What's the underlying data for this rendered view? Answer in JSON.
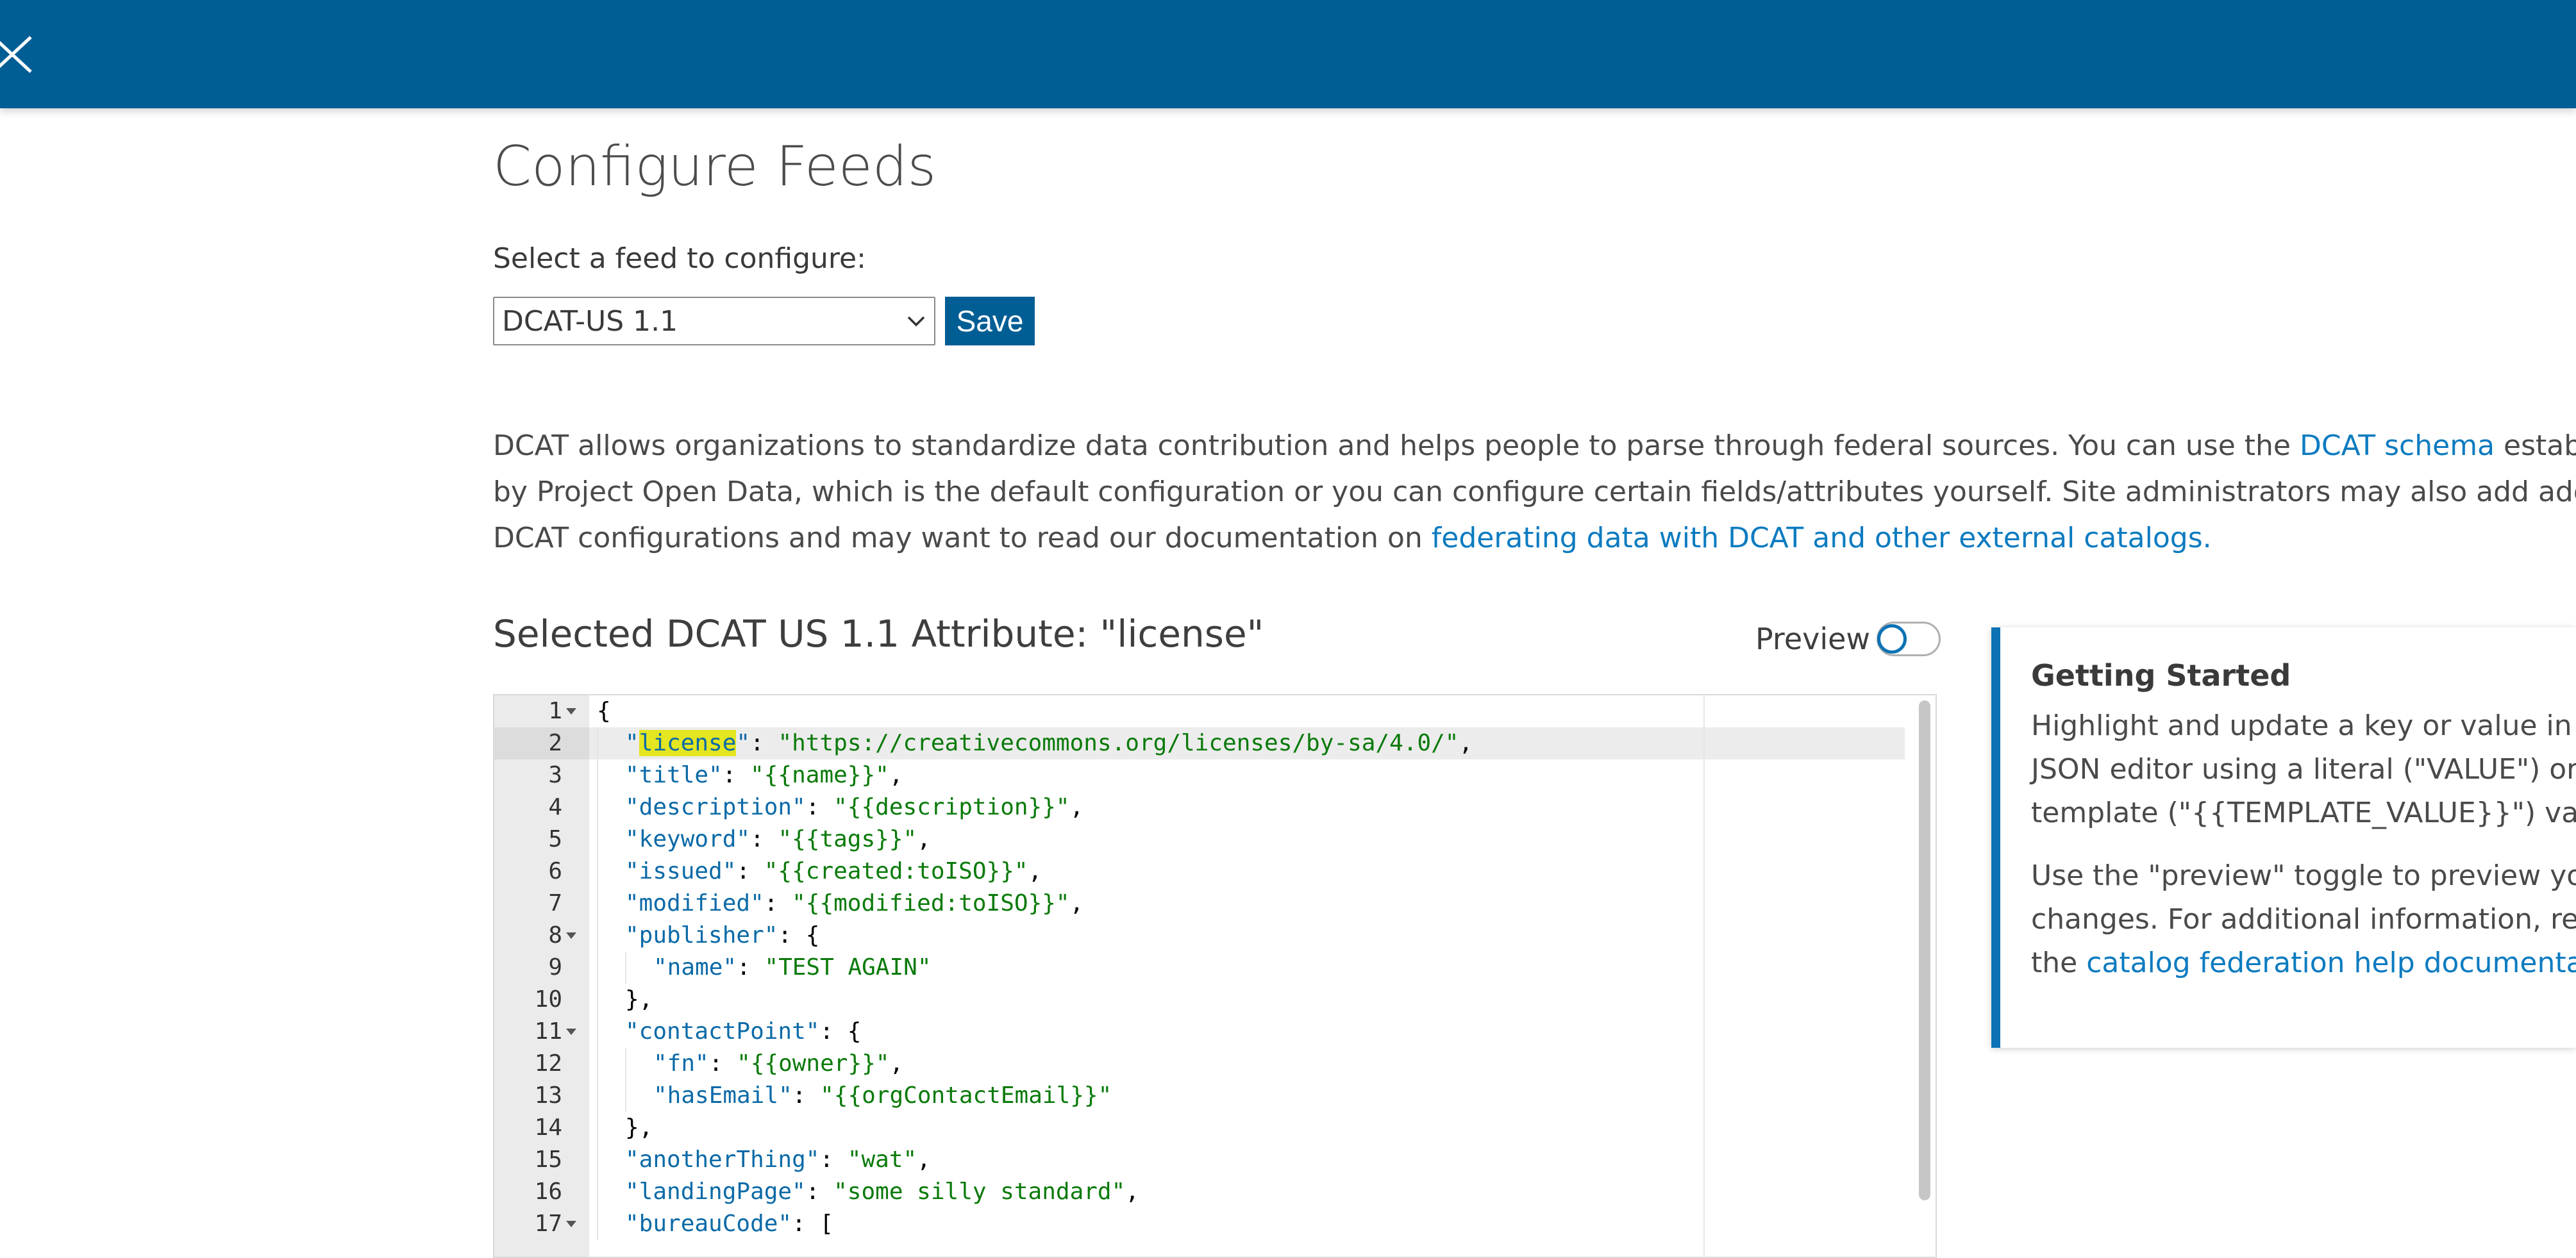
{
  "page": {
    "title": "Configure Feeds",
    "select_label": "Select a feed to configure:",
    "selected_feed": "DCAT-US 1.1",
    "save_label": "Save"
  },
  "description": {
    "line1_text": "DCAT allows organizations to standardize data contribution and helps people to parse through federal sources. You can use the ",
    "schema_link": "DCAT schema",
    "line1_tail": " establi",
    "line2_text": "by Project Open Data, which is the default configuration or you can configure certain fields/attributes yourself. Site administrators may also add additi",
    "line3_text": "DCAT configurations and may want to read our documentation on ",
    "federating_link": "federating data with DCAT and other external catalogs."
  },
  "editor": {
    "attribute_title": "Selected DCAT US 1.1 Attribute: \"license\"",
    "preview_label": "Preview",
    "lines": [
      {
        "n": "1",
        "fold": true,
        "indent": 0,
        "parts": [
          {
            "t": "{",
            "c": "p"
          }
        ]
      },
      {
        "n": "2",
        "fold": false,
        "indent": 1,
        "parts": [
          {
            "t": "\"",
            "c": "k"
          },
          {
            "t": "license",
            "c": "k",
            "hl": true
          },
          {
            "t": "\"",
            "c": "k"
          },
          {
            "t": ": ",
            "c": "p"
          },
          {
            "t": "\"https://creativecommons.org/licenses/by-sa/4.0/\"",
            "c": "s"
          },
          {
            "t": ",",
            "c": "p"
          }
        ]
      },
      {
        "n": "3",
        "fold": false,
        "indent": 1,
        "parts": [
          {
            "t": "\"title\"",
            "c": "k"
          },
          {
            "t": ": ",
            "c": "p"
          },
          {
            "t": "\"{{name}}\"",
            "c": "s"
          },
          {
            "t": ",",
            "c": "p"
          }
        ]
      },
      {
        "n": "4",
        "fold": false,
        "indent": 1,
        "parts": [
          {
            "t": "\"description\"",
            "c": "k"
          },
          {
            "t": ": ",
            "c": "p"
          },
          {
            "t": "\"{{description}}\"",
            "c": "s"
          },
          {
            "t": ",",
            "c": "p"
          }
        ]
      },
      {
        "n": "5",
        "fold": false,
        "indent": 1,
        "parts": [
          {
            "t": "\"keyword\"",
            "c": "k"
          },
          {
            "t": ": ",
            "c": "p"
          },
          {
            "t": "\"{{tags}}\"",
            "c": "s"
          },
          {
            "t": ",",
            "c": "p"
          }
        ]
      },
      {
        "n": "6",
        "fold": false,
        "indent": 1,
        "parts": [
          {
            "t": "\"issued\"",
            "c": "k"
          },
          {
            "t": ": ",
            "c": "p"
          },
          {
            "t": "\"{{created:toISO}}\"",
            "c": "s"
          },
          {
            "t": ",",
            "c": "p"
          }
        ]
      },
      {
        "n": "7",
        "fold": false,
        "indent": 1,
        "parts": [
          {
            "t": "\"modified\"",
            "c": "k"
          },
          {
            "t": ": ",
            "c": "p"
          },
          {
            "t": "\"{{modified:toISO}}\"",
            "c": "s"
          },
          {
            "t": ",",
            "c": "p"
          }
        ]
      },
      {
        "n": "8",
        "fold": true,
        "indent": 1,
        "parts": [
          {
            "t": "\"publisher\"",
            "c": "k"
          },
          {
            "t": ": {",
            "c": "p"
          }
        ]
      },
      {
        "n": "9",
        "fold": false,
        "indent": 2,
        "parts": [
          {
            "t": "\"name\"",
            "c": "k"
          },
          {
            "t": ": ",
            "c": "p"
          },
          {
            "t": "\"TEST AGAIN\"",
            "c": "s"
          }
        ]
      },
      {
        "n": "10",
        "fold": false,
        "indent": 1,
        "parts": [
          {
            "t": "},",
            "c": "p"
          }
        ]
      },
      {
        "n": "11",
        "fold": true,
        "indent": 1,
        "parts": [
          {
            "t": "\"contactPoint\"",
            "c": "k"
          },
          {
            "t": ": {",
            "c": "p"
          }
        ]
      },
      {
        "n": "12",
        "fold": false,
        "indent": 2,
        "parts": [
          {
            "t": "\"fn\"",
            "c": "k"
          },
          {
            "t": ": ",
            "c": "p"
          },
          {
            "t": "\"{{owner}}\"",
            "c": "s"
          },
          {
            "t": ",",
            "c": "p"
          }
        ]
      },
      {
        "n": "13",
        "fold": false,
        "indent": 2,
        "parts": [
          {
            "t": "\"hasEmail\"",
            "c": "k"
          },
          {
            "t": ": ",
            "c": "p"
          },
          {
            "t": "\"{{orgContactEmail}}\"",
            "c": "s"
          }
        ]
      },
      {
        "n": "14",
        "fold": false,
        "indent": 1,
        "parts": [
          {
            "t": "},",
            "c": "p"
          }
        ]
      },
      {
        "n": "15",
        "fold": false,
        "indent": 1,
        "parts": [
          {
            "t": "\"anotherThing\"",
            "c": "k"
          },
          {
            "t": ": ",
            "c": "p"
          },
          {
            "t": "\"wat\"",
            "c": "s"
          },
          {
            "t": ",",
            "c": "p"
          }
        ]
      },
      {
        "n": "16",
        "fold": false,
        "indent": 1,
        "parts": [
          {
            "t": "\"landingPage\"",
            "c": "k"
          },
          {
            "t": ": ",
            "c": "p"
          },
          {
            "t": "\"some silly standard\"",
            "c": "s"
          },
          {
            "t": ",",
            "c": "p"
          }
        ]
      },
      {
        "n": "17",
        "fold": true,
        "indent": 1,
        "parts": [
          {
            "t": "\"bureauCode\"",
            "c": "k"
          },
          {
            "t": ": [",
            "c": "p"
          }
        ]
      }
    ]
  },
  "help_card": {
    "title": "Getting Started",
    "p1_line1": "Highlight and update a key or value in t",
    "p1_line2": "JSON editor using a literal (\"VALUE\") or",
    "p1_line3": "template (\"{{TEMPLATE_VALUE}}\") valu",
    "p2_line1": "Use the \"preview\" toggle to preview yo",
    "p2_line2": "changes. For additional information, rea",
    "p2_line3_text": "the ",
    "p2_link": "catalog federation help documenta"
  },
  "colors": {
    "header": "#005e95",
    "accent": "#0c72b5",
    "link": "#0c7bc0",
    "json_key": "#0b6aa7",
    "json_string": "#0a7a0a",
    "highlight": "#e3e620"
  },
  "icons": {
    "close": "close-icon",
    "select_arrow": "chevron-down-icon"
  }
}
